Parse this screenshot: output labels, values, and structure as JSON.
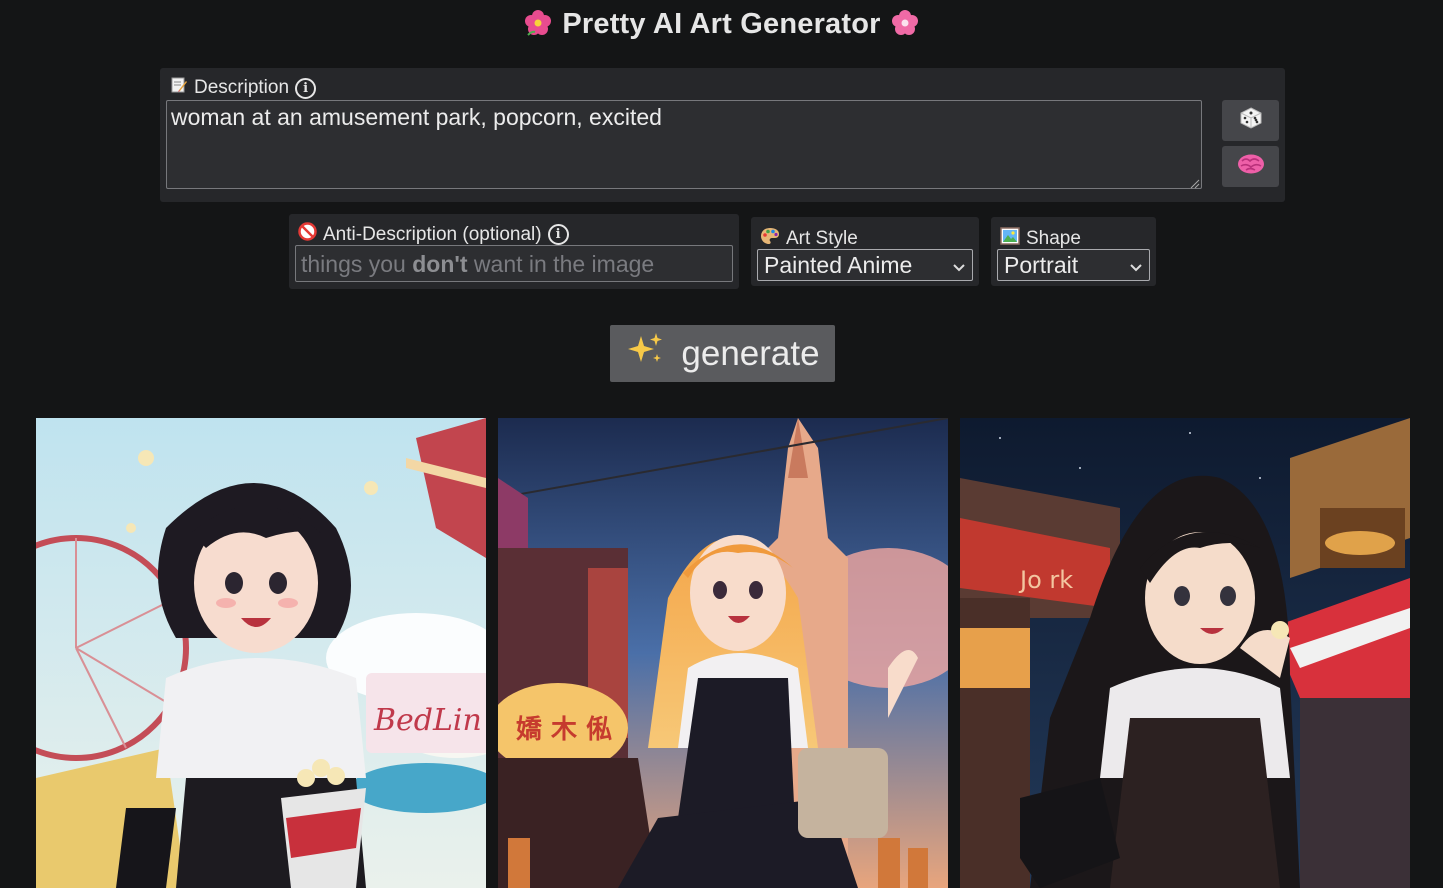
{
  "app": {
    "title": "Pretty AI Art Generator",
    "title_icon": "hibiscus-flower"
  },
  "description": {
    "label": "Description",
    "value": "woman at an amusement park, popcorn, excited",
    "label_icon": "memo-icon",
    "random_button_icon": "dice-icon",
    "brain_button_icon": "brain-icon"
  },
  "anti_description": {
    "label": "Anti-Description (optional)",
    "label_icon": "no-entry-icon",
    "placeholder_pre": "things you ",
    "placeholder_bold": "don't",
    "placeholder_post": " want in the image"
  },
  "art_style": {
    "label": "Art Style",
    "label_icon": "palette-icon",
    "selected": "Painted Anime"
  },
  "shape": {
    "label": "Shape",
    "label_icon": "picture-icon",
    "selected": "Portrait"
  },
  "generate": {
    "label": "generate",
    "icon": "sparkles-icon"
  },
  "results": [
    {
      "alt": "anime woman at amusement park with ferris wheel and popcorn"
    },
    {
      "alt": "anime woman with orange hair in front of castle"
    },
    {
      "alt": "anime woman at night market eating popcorn"
    }
  ]
}
